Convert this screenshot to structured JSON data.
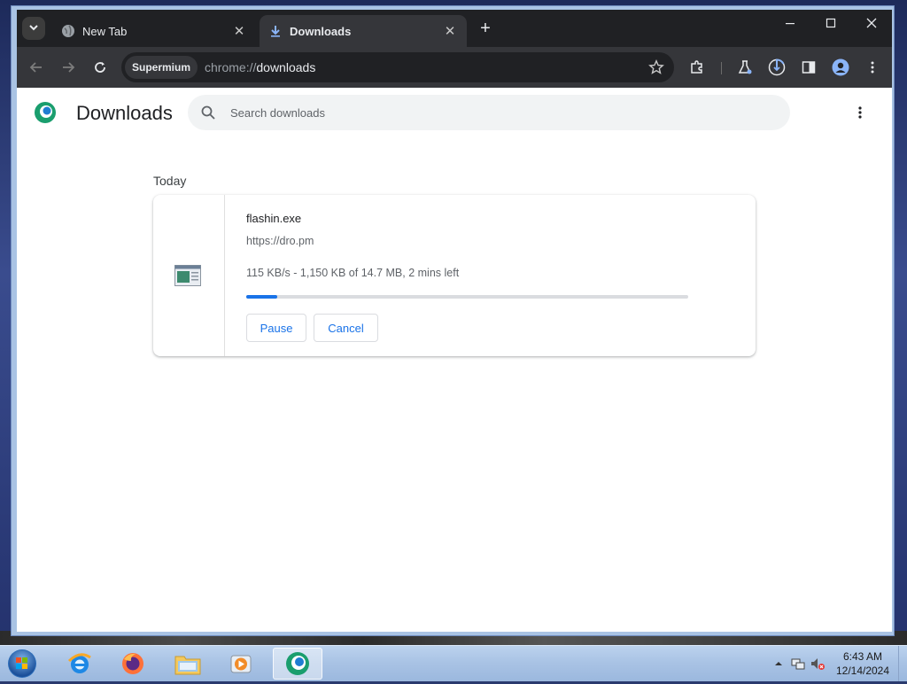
{
  "browser": {
    "tabs": [
      {
        "label": "New Tab",
        "icon": "globe-icon",
        "active": false
      },
      {
        "label": "Downloads",
        "icon": "download-icon",
        "active": true
      }
    ],
    "omnibox": {
      "site_chip": "Supermium",
      "url_scheme": "chrome://",
      "url_host": "downloads"
    }
  },
  "page": {
    "title": "Downloads",
    "search": {
      "placeholder": "Search downloads",
      "value": ""
    },
    "section_date": "Today",
    "downloads": [
      {
        "file_name": "flashin.exe",
        "url": "https://dro.pm",
        "status": "115 KB/s - 1,150 KB of 14.7 MB, 2 mins left",
        "progress": 0.07,
        "pause_label": "Pause",
        "cancel_label": "Cancel"
      }
    ]
  },
  "taskbar": {
    "apps": [
      "internet-explorer-icon",
      "firefox-icon",
      "file-explorer-icon",
      "media-player-icon",
      "supermium-icon"
    ],
    "clock": {
      "time": "6:43 AM",
      "date": "12/14/2024"
    }
  },
  "colors": {
    "accent": "#1a73e8",
    "tab_strip": "#202124",
    "toolbar": "#35363a"
  }
}
